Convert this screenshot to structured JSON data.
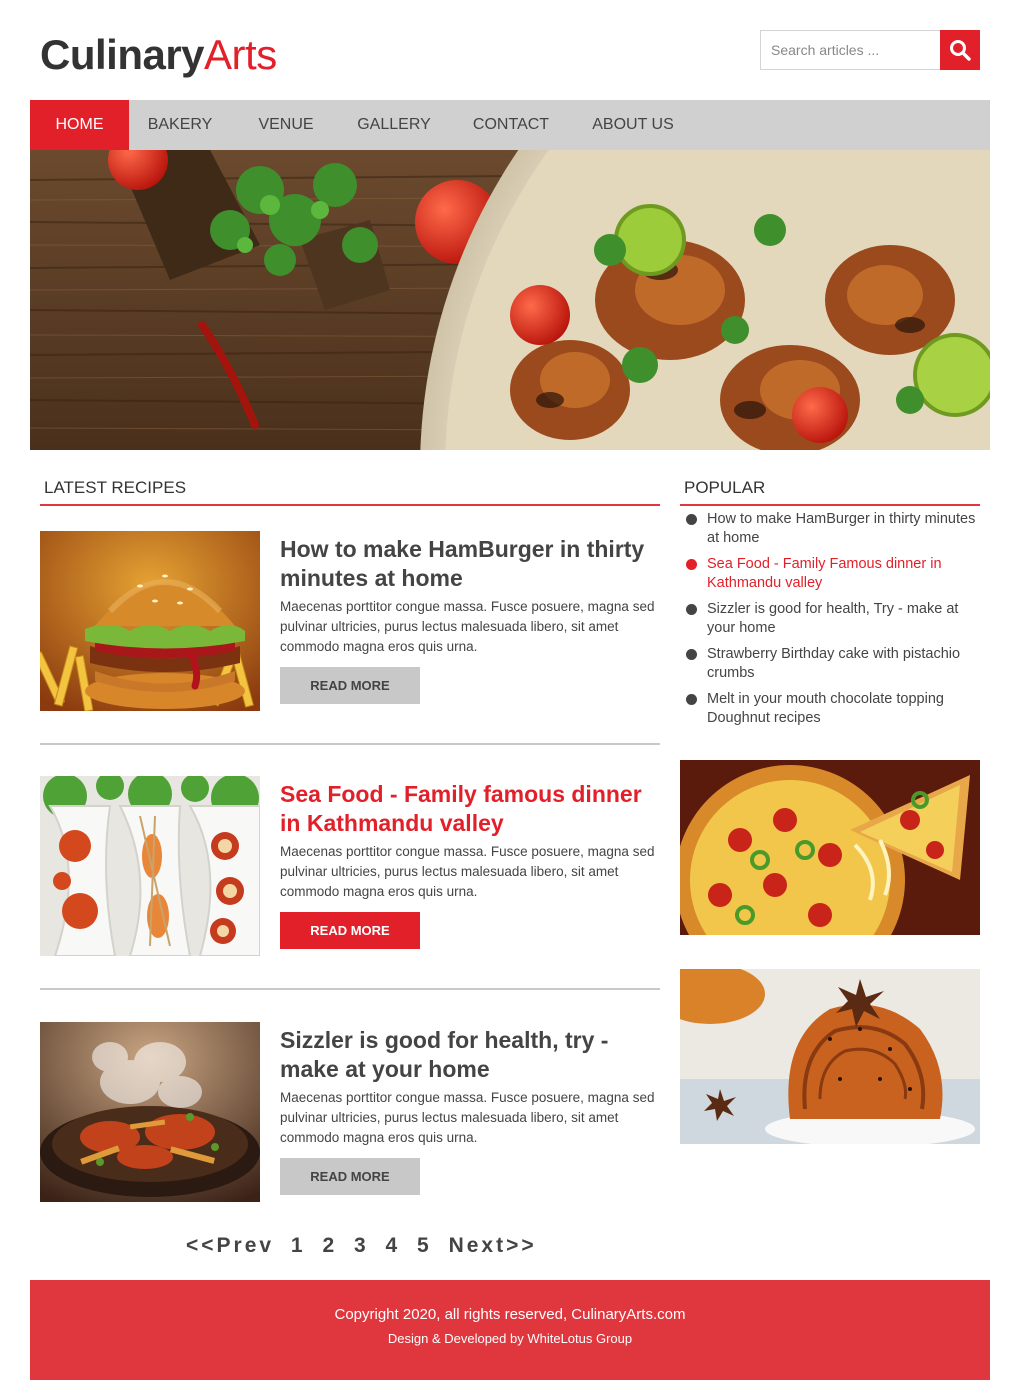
{
  "brand": {
    "part1": "Culinary",
    "part2": "Arts"
  },
  "search": {
    "placeholder": "Search articles ..."
  },
  "nav": [
    "HOME",
    "BAKERY",
    "VENUE",
    "GALLERY",
    "CONTACT",
    "ABOUT US"
  ],
  "latest": {
    "heading": "LATEST RECIPES",
    "items": [
      {
        "title": "How to make HamBurger in thirty minutes at home",
        "desc": "Maecenas porttitor congue massa. Fusce posuere, magna sed pulvinar ultricies, purus lectus malesuada libero, sit amet commodo magna eros quis urna.",
        "button": "READ MORE"
      },
      {
        "title": "Sea Food - Family famous dinner in Kathmandu valley",
        "desc": "Maecenas porttitor congue massa. Fusce posuere, magna sed pulvinar ultricies, purus lectus malesuada libero, sit amet commodo magna eros quis urna.",
        "button": "READ MORE"
      },
      {
        "title": "Sizzler is good for health, try - make at your home",
        "desc": "Maecenas porttitor congue massa. Fusce posuere, magna sed pulvinar ultricies, purus lectus malesuada libero, sit amet commodo magna eros quis urna.",
        "button": "READ MORE"
      }
    ]
  },
  "popular": {
    "heading": "POPULAR",
    "items": [
      "How to make HamBurger in thirty minutes at home",
      "Sea Food - Family Famous dinner in Kathmandu valley",
      "Sizzler is good for health, Try - make at your home",
      "Strawberry Birthday cake with pistachio crumbs",
      "Melt in your mouth chocolate topping Doughnut recipes"
    ]
  },
  "pager": {
    "prev": "<<Prev",
    "pages": [
      "1",
      "2",
      "3",
      "4",
      "5"
    ],
    "next": "Next>>"
  },
  "footer": {
    "copyright": "Copyright 2020, all rights reserved, CulinaryArts.com",
    "credit": "Design & Developed by WhiteLotus Group"
  },
  "colors": {
    "accent": "#e2202a",
    "nav_bg": "#d0d0d0",
    "footer_bg": "#e0363d",
    "text": "#444444"
  }
}
